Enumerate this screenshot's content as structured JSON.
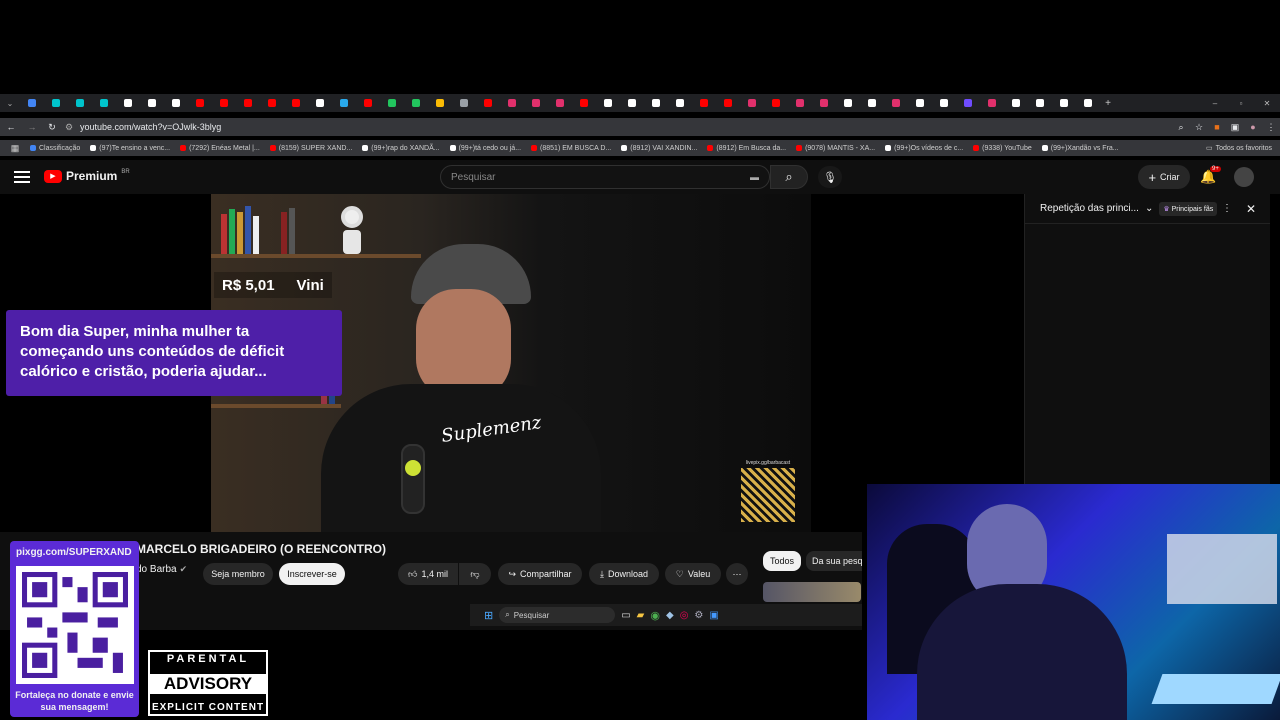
{
  "browser": {
    "url": "youtube.com/watch?v=OJwlk-3blyg",
    "bookmarks": [
      {
        "label": "Classificação",
        "color": "#4285f4"
      },
      {
        "label": "(97)Te ensino a venc...",
        "color": "#ffffff"
      },
      {
        "label": "(7292) Enéas Metal |...",
        "color": "#ff0000"
      },
      {
        "label": "(8159) SUPER XAND...",
        "color": "#ff0000"
      },
      {
        "label": "(99+)rap do XANDÃ...",
        "color": "#ffffff"
      },
      {
        "label": "(99+)tá cedo ou já...",
        "color": "#ffffff"
      },
      {
        "label": "(8851) EM BUSCA D...",
        "color": "#ff0000"
      },
      {
        "label": "(8912) VAI XANDIN...",
        "color": "#ffffff"
      },
      {
        "label": "(8912) Em Busca da...",
        "color": "#ff0000"
      },
      {
        "label": "(9078) MANTIS - XA...",
        "color": "#ff0000"
      },
      {
        "label": "(99+)Os vídeos de c...",
        "color": "#ffffff"
      },
      {
        "label": "(9338) YouTube",
        "color": "#ff0000"
      },
      {
        "label": "(99+)Xandão vs Fra...",
        "color": "#ffffff"
      }
    ],
    "all_favorites": "Todos os favoritos"
  },
  "youtube": {
    "logo": "Premium",
    "logo_region": "BR",
    "search_placeholder": "Pesquisar",
    "create_label": "Criar",
    "notifications_count": "9+",
    "video_title": "MARCELO BRIGADEIRO (O REENCONTRO)",
    "channel_name": "do Barba",
    "member_label": "Seja membro",
    "subscribe_label": "Inscrever-se",
    "likes": "1,4 mil",
    "share_label": "Compartilhar",
    "download_label": "Download",
    "thanks_label": "Valeu",
    "filter_all": "Todos",
    "filter_search": "Da sua pesq"
  },
  "side_panel": {
    "title": "Repetição das princi...",
    "badge": "Principais fãs"
  },
  "video_overlay": {
    "qr_caption": "livepix.gg/barbacast"
  },
  "taskbar": {
    "search_label": "Pesquisar"
  },
  "stream_overlay": {
    "donation_amount": "R$ 5,01",
    "donor_name": "Vini",
    "chat_message": "Bom dia Super, minha mulher ta começando uns conteúdos de déficit calórico e cristão, poderia ajudar...",
    "pix_url": "pixgg.com/SUPERXAND",
    "pix_caption": "Fortaleça no donate e envie sua mensagem!",
    "advisory_top": "PARENTAL",
    "advisory_main": "ADVISORY",
    "advisory_bottom": "EXPLICIT CONTENT"
  },
  "colors": {
    "youtube_red": "#ff0000",
    "chat_purple": "#4e1fa8",
    "pix_purple": "#5b2bd6"
  }
}
